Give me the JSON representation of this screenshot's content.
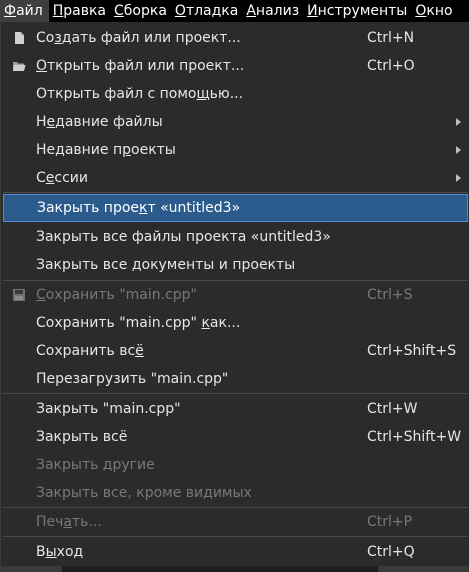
{
  "menubar": {
    "items": [
      {
        "pre": "",
        "u": "Ф",
        "post": "айл"
      },
      {
        "pre": "",
        "u": "П",
        "post": "равка"
      },
      {
        "pre": "",
        "u": "С",
        "post": "борка"
      },
      {
        "pre": "",
        "u": "О",
        "post": "тладка"
      },
      {
        "pre": "",
        "u": "А",
        "post": "нализ"
      },
      {
        "pre": "",
        "u": "И",
        "post": "нструменты"
      },
      {
        "pre": "",
        "u": "О",
        "post": "кно"
      }
    ]
  },
  "file_menu": {
    "items": [
      {
        "pre": "Со",
        "u": "з",
        "post": "дать файл или проект...",
        "shortcut": "Ctrl+N",
        "icon": "new-file-icon"
      },
      {
        "pre": "",
        "u": "О",
        "post": "ткрыть файл или проект...",
        "shortcut": "Ctrl+O",
        "icon": "open-folder-icon"
      },
      {
        "pre": "Открыть файл с помо",
        "u": "щ",
        "post": "ью..."
      },
      {
        "pre": "Н",
        "u": "е",
        "post": "давние файлы"
      },
      {
        "pre": "Недавние п",
        "u": "р",
        "post": "оекты"
      },
      {
        "pre": "С",
        "u": "е",
        "post": "ссии"
      },
      {
        "pre": "Закрыть прое",
        "u": "к",
        "post": "т «untitled3»"
      },
      {
        "pre": "Закрыть все файлы проекта «untitled3»",
        "u": "",
        "post": ""
      },
      {
        "pre": "Закрыть все документы и проекты",
        "u": "",
        "post": ""
      },
      {
        "pre": "",
        "u": "С",
        "post": "охранить \"main.cpp\"",
        "shortcut": "Ctrl+S",
        "icon": "save-icon"
      },
      {
        "pre": "Сохранить \"main.cpp\" ",
        "u": "к",
        "post": "ак..."
      },
      {
        "pre": "Сохранить вс",
        "u": "ё",
        "post": "",
        "shortcut": "Ctrl+Shift+S"
      },
      {
        "pre": "Перезагрузить \"main.cpp\"",
        "u": "",
        "post": ""
      },
      {
        "pre": "Закрыть \"main.cpp\"",
        "u": "",
        "post": "",
        "shortcut": "Ctrl+W"
      },
      {
        "pre": "Закрыть всё",
        "u": "",
        "post": "",
        "shortcut": "Ctrl+Shift+W"
      },
      {
        "pre": "Закрыть другие",
        "u": "",
        "post": ""
      },
      {
        "pre": "Закрыть все, кроме видимых",
        "u": "",
        "post": ""
      },
      {
        "pre": "Печ",
        "u": "а",
        "post": "ть...",
        "shortcut": "Ctrl+P"
      },
      {
        "pre": "В",
        "u": "ы",
        "post": "ход",
        "shortcut": "Ctrl+Q"
      }
    ]
  },
  "colors": {
    "highlight": "#2b5b8c",
    "highlight_border": "#4d8fd0",
    "menu_bg": "#2b2b2b",
    "disabled_text": "#787878"
  }
}
